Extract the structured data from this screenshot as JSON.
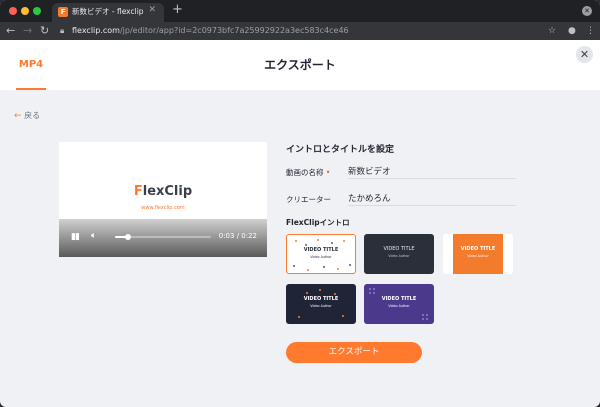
{
  "browser": {
    "tab_title": "新数ビデオ - flexclip",
    "tab_favicon": "F",
    "url_host": "flexclip.com",
    "url_path": "/jp/editor/app?id=2c0973bfc7a25992922a3ec583c4ce46"
  },
  "header": {
    "format_tab": "MP4",
    "title": "エクスポート"
  },
  "back_label": "戻る",
  "preview": {
    "logo_first": "F",
    "logo_rest": "lexClip",
    "logo_url": "www.flexclip.com",
    "time": "0:03 / 0:22",
    "progress": 0.14
  },
  "settings": {
    "section_title": "イントロとタイトルを設定",
    "name_label": "動画の名称",
    "required_mark": "•",
    "name_value": "新数ビデオ",
    "creator_label": "クリエーター",
    "creator_value": "たかめろん",
    "intro_label": "FlexClipイントロ"
  },
  "intros": [
    {
      "title": "VIDEO TITLE",
      "subtitle": "Video Author"
    },
    {
      "title": "VIDEO TITLE",
      "subtitle": "Video Author"
    },
    {
      "title": "VIDEO TITLE",
      "subtitle": "Video Author"
    },
    {
      "title": "VIDEO TITLE",
      "subtitle": "Video Author"
    },
    {
      "title": "VIDEO TITLE",
      "subtitle": "Video Author"
    }
  ],
  "export_button": "エクスポート",
  "colors": {
    "accent": "#ff7a2f",
    "text": "#1f2430",
    "background": "#f0f1f5"
  }
}
